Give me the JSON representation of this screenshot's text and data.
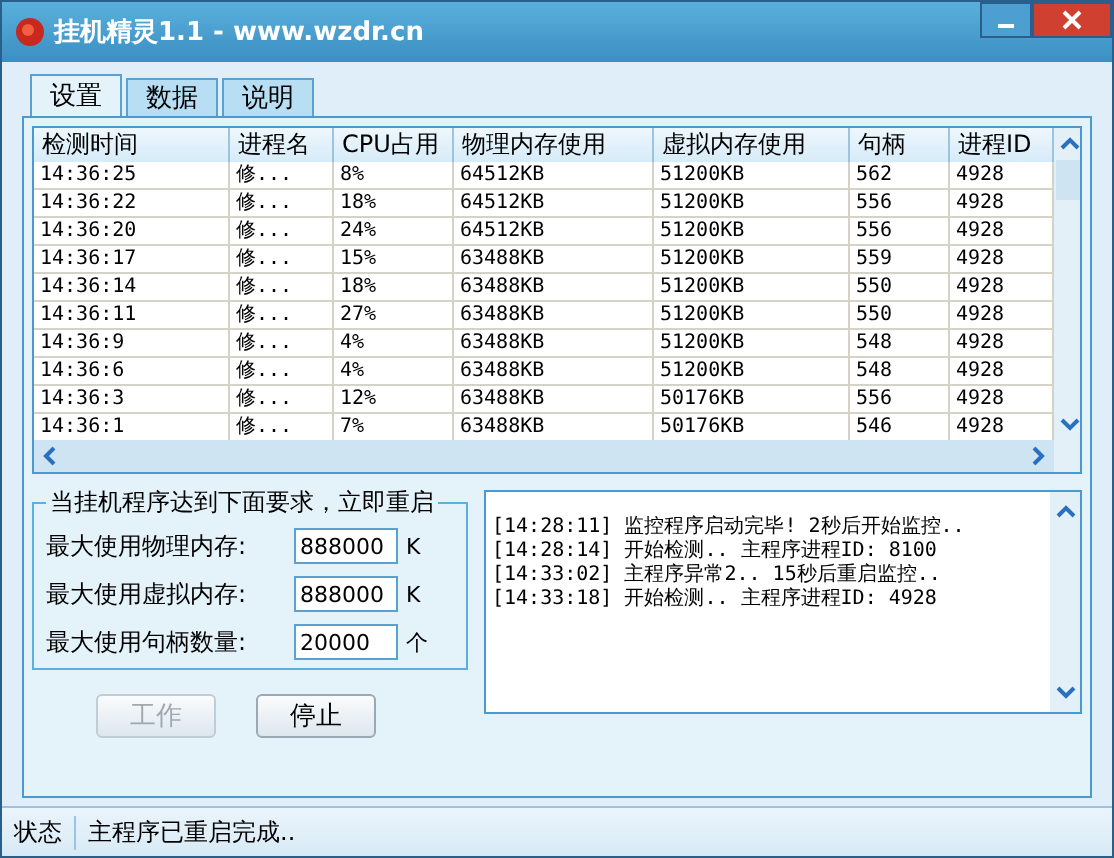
{
  "window": {
    "title": "挂机精灵1.1 - www.wzdr.cn"
  },
  "tabs": [
    {
      "label": "设置",
      "selected": true
    },
    {
      "label": "数据",
      "selected": false
    },
    {
      "label": "说明",
      "selected": false
    }
  ],
  "table": {
    "columns": [
      "检测时间",
      "进程名",
      "CPU占用",
      "物理内存使用",
      "虚拟内存使用",
      "句柄",
      "进程ID"
    ],
    "rows": [
      [
        "14:36:25",
        "修...",
        "8%",
        "64512KB",
        "51200KB",
        "562",
        "4928"
      ],
      [
        "14:36:22",
        "修...",
        "18%",
        "64512KB",
        "51200KB",
        "556",
        "4928"
      ],
      [
        "14:36:20",
        "修...",
        "24%",
        "64512KB",
        "51200KB",
        "556",
        "4928"
      ],
      [
        "14:36:17",
        "修...",
        "15%",
        "63488KB",
        "51200KB",
        "559",
        "4928"
      ],
      [
        "14:36:14",
        "修...",
        "18%",
        "63488KB",
        "51200KB",
        "550",
        "4928"
      ],
      [
        "14:36:11",
        "修...",
        "27%",
        "63488KB",
        "51200KB",
        "550",
        "4928"
      ],
      [
        "14:36:9",
        "修...",
        "4%",
        "63488KB",
        "51200KB",
        "548",
        "4928"
      ],
      [
        "14:36:6",
        "修...",
        "4%",
        "63488KB",
        "51200KB",
        "548",
        "4928"
      ],
      [
        "14:36:3",
        "修...",
        "12%",
        "63488KB",
        "50176KB",
        "556",
        "4928"
      ],
      [
        "14:36:1",
        "修...",
        "7%",
        "63488KB",
        "50176KB",
        "546",
        "4928"
      ]
    ]
  },
  "restart_group": {
    "title": "当挂机程序达到下面要求，立即重启",
    "fields": [
      {
        "label": "最大使用物理内存:",
        "value": "888000",
        "unit": "K"
      },
      {
        "label": "最大使用虚拟内存:",
        "value": "888000",
        "unit": "K"
      },
      {
        "label": "最大使用句柄数量:",
        "value": "20000",
        "unit": "个"
      }
    ]
  },
  "log": [
    "[14:28:11] 监控程序启动完毕! 2秒后开始监控..",
    "[14:28:14] 开始检测.. 主程序进程ID: 8100",
    "[14:33:02] 主程序异常2.. 15秒后重启监控..",
    "[14:33:18] 开始检测.. 主程序进程ID: 4928"
  ],
  "buttons": [
    {
      "label": "工作",
      "disabled": true
    },
    {
      "label": "停止",
      "disabled": false
    }
  ],
  "status_bar": {
    "label": "状态",
    "message": "主程序已重启完成.."
  }
}
